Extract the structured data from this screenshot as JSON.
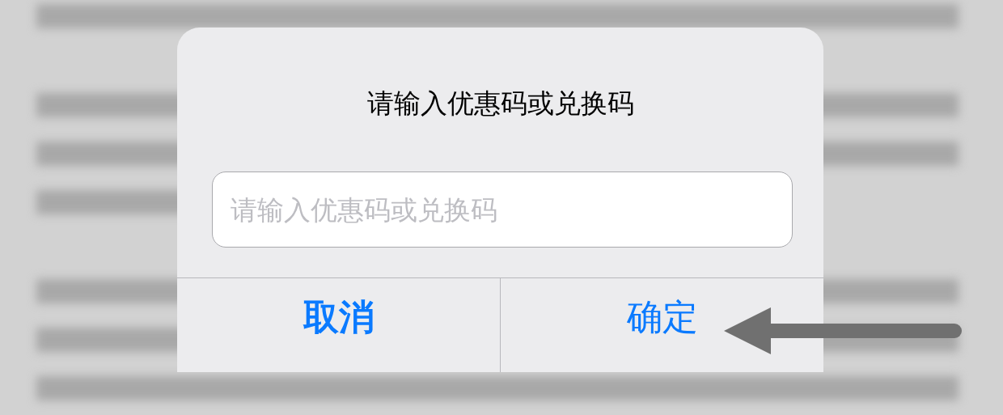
{
  "dialog": {
    "title": "请输入优惠码或兑换码",
    "input": {
      "placeholder": "请输入优惠码或兑换码"
    },
    "buttons": [
      {
        "label": "取消",
        "kind": "cancel"
      },
      {
        "label": "确定",
        "kind": "confirm"
      }
    ]
  }
}
